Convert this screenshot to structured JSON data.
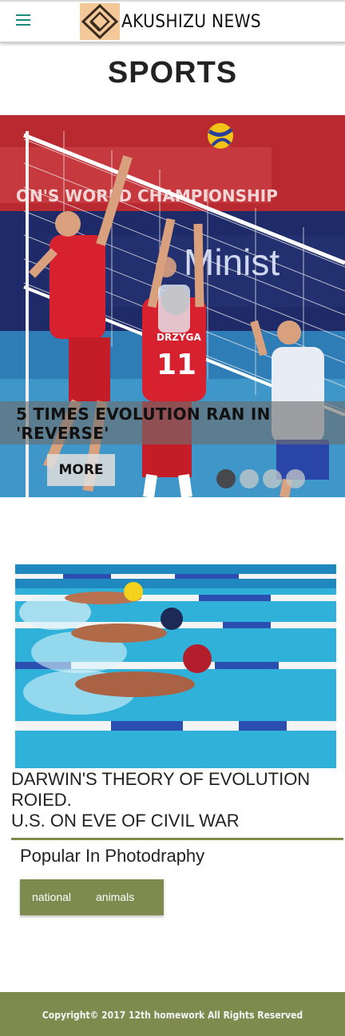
{
  "header": {
    "brand_name": "AKUSHIZU NEWS",
    "logo_icon": "diamond-logo-icon",
    "menu_icon": "hamburger-menu-icon",
    "accent_color": "#1a8a7c"
  },
  "page": {
    "title": "SPORTS"
  },
  "carousel": {
    "caption": "5 TIMES EVOLUTION RAN IN 'REVERSE'",
    "more_label": "MORE",
    "slide_count": 4,
    "active_slide": 1,
    "banner_text": "ON'S WORLD CHAMPIONSHIP",
    "sponsor_text": "Minist",
    "jersey_name": "DRZYGA",
    "jersey_number": "11"
  },
  "article2": {
    "title_lines": [
      "DARWIN'S THEORY OF EVOLUTION",
      "ROIED.",
      "U.S. ON EVE OF CIVIL WAR"
    ]
  },
  "popular": {
    "heading": "Popular In Photodraphy",
    "tags": [
      "national",
      "animals"
    ],
    "tag_color": "#7d8b4f"
  },
  "footer": {
    "text": "Copyright© 2017 12th homework All Rights Reserved",
    "color": "#7d8b4f"
  }
}
